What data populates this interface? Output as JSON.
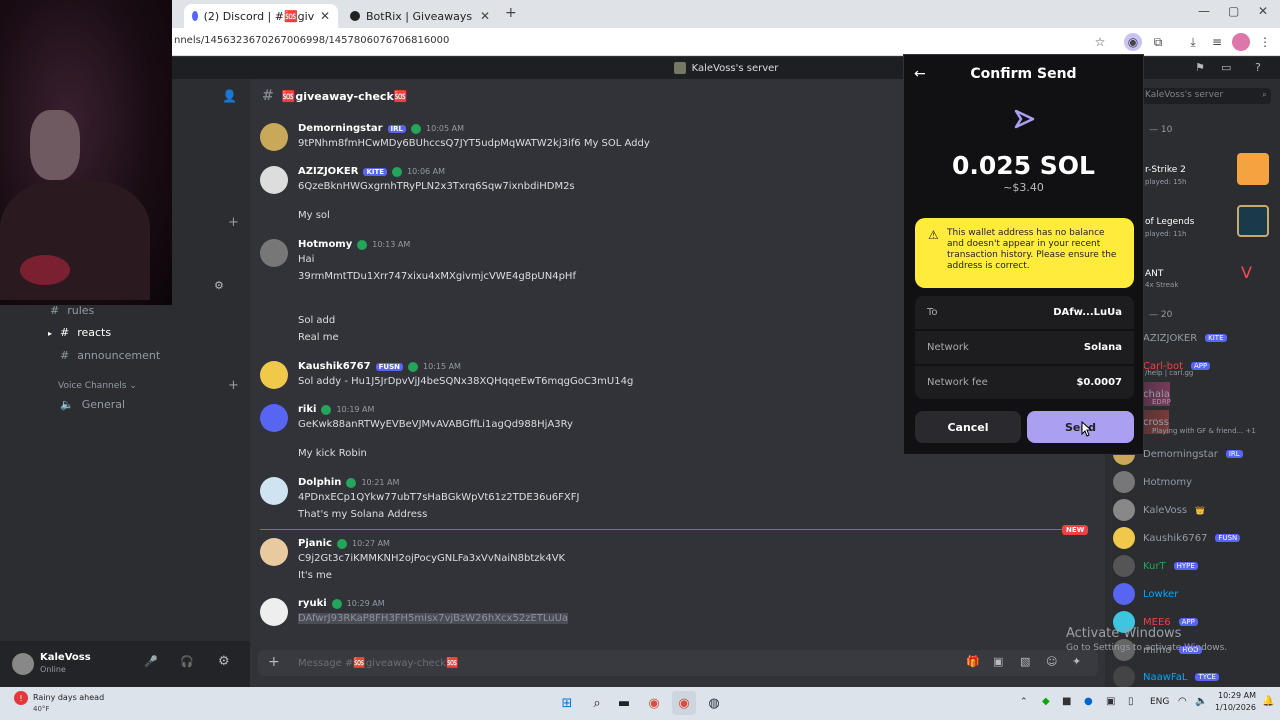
{
  "browser": {
    "tabs": [
      {
        "label": "(2) Discord | #🆘giveaway-check🆘",
        "active": true
      },
      {
        "label": "BotRix | Giveaways",
        "active": false
      }
    ],
    "url": "nnels/1456323670267006998/1457806076706816000"
  },
  "discord": {
    "server_title": "KaleVoss's server",
    "channel_header": "🆘giveaway-check🆘",
    "sidebar": {
      "channels": [
        {
          "label": "rules",
          "selected": false
        },
        {
          "label": "reacts",
          "selected": true
        },
        {
          "label": "announcement",
          "selected": false
        }
      ],
      "voice_category": "Voice Channels",
      "voice_channels": [
        "General"
      ]
    },
    "user": {
      "name": "KaleVoss",
      "status": "Online"
    },
    "messages": [
      {
        "author": "Demorningstar",
        "tag": "IRL",
        "time": "10:05 AM",
        "lines": [
          "9tPNhm8fmHCwMDy6BUhccsQ7JYT5udpMqWATW2kj3if6 My SOL Addy"
        ]
      },
      {
        "author": "AZIZJOKER",
        "tag": "KITE",
        "time": "10:06 AM",
        "lines": [
          "6QzeBknHWGxgrnhTRyPLN2x3Txrq6Sqw7ixnbdiHDM2s",
          "My sol"
        ]
      },
      {
        "author": "Hotmomy",
        "tag": "",
        "time": "10:13 AM",
        "lines": [
          "Hai",
          "39rmMmtTDu1Xrr747xixu4xMXgivmjcVWE4g8pUN4pHf",
          "Sol add",
          "Real me"
        ]
      },
      {
        "author": "Kaushik6767",
        "tag": "FUSN",
        "time": "10:15 AM",
        "lines": [
          "Sol addy - Hu1J5JrDpvVjJ4beSQNx38XQHqqeEwT6mqgGoC3mU14g"
        ]
      },
      {
        "author": "riki",
        "tag": "",
        "time": "10:19 AM",
        "lines": [
          "GeKwk88anRTWyEVBeVJMvAVABGffLi1agQd988HjA3Ry",
          "My kick Robin"
        ]
      },
      {
        "author": "Dolphin",
        "tag": "",
        "time": "10:21 AM",
        "lines": [
          "4PDnxECp1QYkw77ubT7sHaBGkWpVt61z2TDE36u6FXFJ",
          "That's my Solana Address"
        ]
      },
      {
        "author": "Pjanic",
        "tag": "",
        "time": "10:27 AM",
        "lines": [
          "C9j2Gt3c7iKMMKNH2ojPocyGNLFa3xVvNaiN8btzk4VK",
          "It's me"
        ]
      },
      {
        "author": "ryuki",
        "tag": "",
        "time": "10:29 AM",
        "lines": [
          "DAfwrJ93RKaP8FH3FH5misx7vjBzW26hXcx52zETLuUa"
        ]
      }
    ],
    "new_badge": "NEW",
    "input_placeholder": "Message #🆘giveaway-check🆘",
    "members": {
      "search_placeholder": "KaleVoss's server",
      "group_label_1": "— 10",
      "activities": [
        {
          "title": "r-Strike 2",
          "sub": "played: 15h"
        },
        {
          "title": "of Legends",
          "sub": "played: 11h"
        },
        {
          "title": "ANT",
          "sub": "4x Streak"
        }
      ],
      "group_label_2": "— 20",
      "list": [
        {
          "name": "AZIZJOKER",
          "tag": "KITE",
          "color": "#949ba4"
        },
        {
          "name": "Carl-bot",
          "tag": "APP",
          "color": "#ed4245"
        },
        {
          "name": "chala",
          "tag": "",
          "color": "#949ba4"
        },
        {
          "name": "cross",
          "tag": "",
          "color": "#949ba4"
        },
        {
          "name": "Demorningstar",
          "tag": "IRL",
          "color": "#949ba4"
        },
        {
          "name": "Hotmomy",
          "tag": "",
          "color": "#949ba4"
        },
        {
          "name": "KaleVoss",
          "tag": "👑",
          "color": "#949ba4"
        },
        {
          "name": "Kaushik6767",
          "tag": "FUSN",
          "color": "#949ba4"
        },
        {
          "name": "KurT",
          "tag": "HYPE",
          "color": "#23a55a"
        },
        {
          "name": "Lowker",
          "tag": "",
          "color": "#00a8fc"
        },
        {
          "name": "MEE6",
          "tag": "APP",
          "color": "#ed4245"
        },
        {
          "name": "mimo",
          "tag": "HOD",
          "color": "#949ba4"
        },
        {
          "name": "NaawFaL",
          "tag": "TYCE",
          "color": "#00a8fc"
        }
      ],
      "carl_sub": "/help | carl.gg",
      "chala_sub": "EDRP",
      "cross_sub": "Playing with GF & friend... +1"
    }
  },
  "wallet_popup": {
    "title": "Confirm Send",
    "amount": "0.025 SOL",
    "usd": "~$3.40",
    "warning": "This wallet address has no balance and doesn't appear in your recent transaction history. Please ensure the address is correct.",
    "rows": [
      {
        "label": "To",
        "value": "DAfw...LuUa"
      },
      {
        "label": "Network",
        "value": "Solana"
      },
      {
        "label": "Network fee",
        "value": "$0.0007"
      }
    ],
    "cancel_label": "Cancel",
    "send_label": "Send",
    "accent_color": "#ab9ff2",
    "warning_color": "#ffeb3b"
  },
  "watermark": {
    "line1": "Activate Windows",
    "line2": "Go to Settings to activate Windows."
  },
  "taskbar": {
    "weather_title": "Rainy days ahead",
    "weather_temp": "40°F",
    "lang": "ENG",
    "time": "10:29 AM",
    "date": "1/10/2026"
  }
}
